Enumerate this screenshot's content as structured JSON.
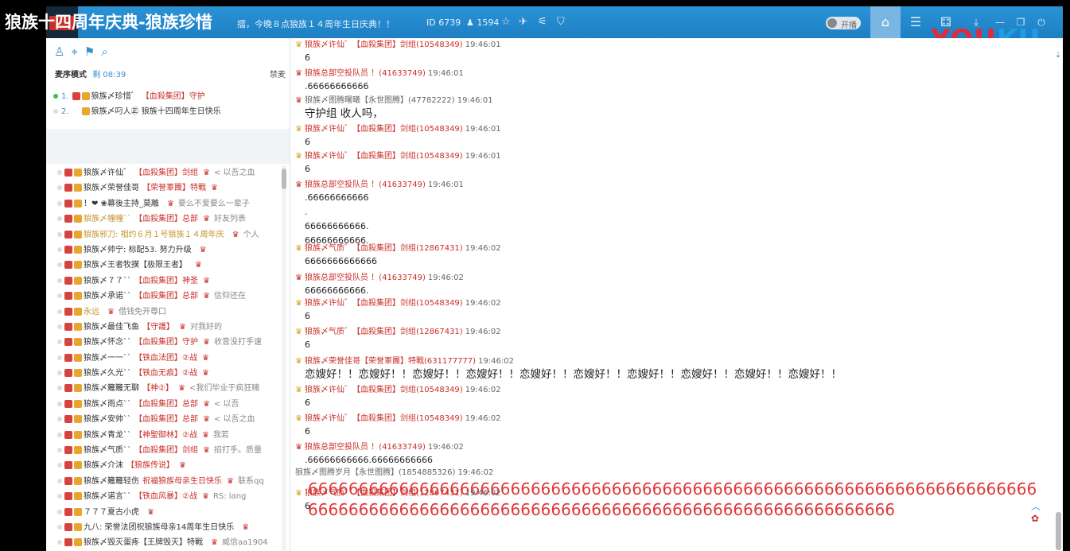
{
  "video_title": "狼族十四周年庆典-狼族珍惜",
  "topbar": {
    "marquee": "擂，今晚８点狼族１４周年生日庆典！！",
    "room_id": "ID 6739",
    "fans": "1594",
    "toggle_label": "开播",
    "icons": [
      "star-icon",
      "plane-icon",
      "share-icon",
      "shield-icon"
    ],
    "nav": [
      "home-icon",
      "list-icon",
      "gamepad-icon",
      "download-icon",
      "minimize-icon",
      "restore-icon",
      "power-icon"
    ]
  },
  "brand": {
    "part1": "YOU",
    "part2": "KU"
  },
  "sidebar": {
    "icons": [
      "user-icon",
      "location-icon",
      "mic-queue-icon",
      "search-icon"
    ],
    "mode_label": "麦序模式",
    "timer": "剩 08:39",
    "ban_label": "禁麦",
    "queue": [
      {
        "num": "1.",
        "name": "狼族〆珍惜゛",
        "tag": "【血殺集团】守护"
      },
      {
        "num": "2.",
        "name": "狼族〆叼人㊣",
        "tag": "狼族十四周年生日快乐"
      }
    ],
    "users": [
      {
        "name": "狼族〆许仙゛",
        "tag": "【血殺集团】剑组",
        "say": "< 以吾之血"
      },
      {
        "name": "狼族〆荣誉佳哥",
        "tag": "【荣誉軍團】特戰",
        "say": ""
      },
      {
        "name": "！❤︎ ❀幕後主持_莫離",
        "tag": "",
        "say": "要么不爱要么一辈子"
      },
      {
        "name": "狼族〆幢幢``",
        "tag": "【血殺集团】总部",
        "say": "好友列表",
        "gold": true
      },
      {
        "name": "狼族邪刀: 相约６月１号狼族１４周年庆",
        "tag": "",
        "say": "个人",
        "gold": true
      },
      {
        "name": "狼族〆帅宁: 标配53. 努力升级",
        "tag": "",
        "say": ""
      },
      {
        "name": "狼族〆王者牧撲【极限王者】",
        "tag": "",
        "say": ""
      },
      {
        "name": "狼族〆７７``",
        "tag": "【血殺集团】神圣",
        "say": ""
      },
      {
        "name": "狼族〆承诺``",
        "tag": "【血殺集团】总部",
        "say": "信仰还在"
      },
      {
        "name": "永远",
        "tag": "",
        "say": "借钱免开尊口",
        "gold": true
      },
      {
        "name": "狼族〆最佳飞鱼",
        "tag": "【守護】",
        "say": "对我好的"
      },
      {
        "name": "狼族〆怀念``",
        "tag": "【血殺集团】守护",
        "say": "收音没打手速"
      },
      {
        "name": "狼族〆一一``",
        "tag": "【铁血法团】②战",
        "say": ""
      },
      {
        "name": "狼族〆久光``",
        "tag": "【铁血无痕】②战",
        "say": ""
      },
      {
        "name": "狼族〆籬籬无聊",
        "tag": "【神②】",
        "say": "<我们毕业于疯狂赌"
      },
      {
        "name": "狼族〆雨点``",
        "tag": "【血殺集团】总部",
        "say": "< 以吾"
      },
      {
        "name": "狼族〆安帅``",
        "tag": "【血殺集团】总部",
        "say": "< 以吾之血"
      },
      {
        "name": "狼族〆青龙``",
        "tag": "【神聖御林】②战",
        "say": "我若"
      },
      {
        "name": "狼族〆气质``",
        "tag": "【血殺集团】剑组",
        "say": "招打手。质量"
      },
      {
        "name": "狼族〆介沫",
        "tag": "【狼族传说】",
        "say": ""
      },
      {
        "name": "狼族〆籬籬轻伤",
        "tag": "祝福狼族母亲生日快乐",
        "say": "联系qq"
      },
      {
        "name": "狼族〆诺言``",
        "tag": "【铁血风暴】②战",
        "say": "RS: lang"
      },
      {
        "name": "７７７夏古小虎",
        "tag": "",
        "say": ""
      },
      {
        "name": "九八: 荣誉法团祝狼族母亲14周年生日快乐",
        "tag": "",
        "say": ""
      },
      {
        "name": "狼族〆毁灭蛋疼【王牌毁灭】特戰",
        "tag": "",
        "say": "威信aa1904"
      }
    ]
  },
  "chat": [
    {
      "name": "狼族〆许仙゛【血殺集团】剑组(10548349)",
      "time": "19:46:01",
      "text": "6",
      "icon": "crown-gold"
    },
    {
      "name": "狼族总部空投队员 ！(41633749)",
      "time": "19:46:01",
      "text": ".66666666666",
      "icon": "crown"
    },
    {
      "name": "狼族〆图腾曙曦【永世图腾】(47782222)",
      "time": "19:46:01",
      "text": "守护组 收人吗，",
      "icon": "crown",
      "gray": true,
      "big": true
    },
    {
      "name": "狼族〆许仙゛【血殺集团】剑组(10548349)",
      "time": "19:46:01",
      "text": "6",
      "icon": "crown-gold"
    },
    {
      "name": "狼族〆许仙゛【血殺集团】剑组(10548349)",
      "time": "19:46:01",
      "text": "6",
      "icon": "crown-gold"
    },
    {
      "name": "狼族总部空投队员 ！(41633749)",
      "time": "19:46:01",
      "text": ".66666666666",
      "icon": "crown",
      "extra": [
        ".",
        "66666666666.",
        "66666666666."
      ]
    },
    {
      "name": "狼族〆气质゛【血殺集团】剑组(12867431)",
      "time": "19:46:02",
      "text": "6666666666666",
      "icon": "crown-gold"
    },
    {
      "name": "狼族总部空投队员 ！(41633749)",
      "time": "19:46:02",
      "text": "66666666666.",
      "icon": "crown"
    },
    {
      "name": "狼族〆许仙゛【血殺集团】剑组(10548349)",
      "time": "19:46:02",
      "text": "6",
      "icon": "crown-gold"
    },
    {
      "name": "狼族〆气质゛【血殺集团】剑组(12867431)",
      "time": "19:46:02",
      "text": "6",
      "icon": "crown-gold"
    },
    {
      "name": "狼族〆荣誉佳哥【荣誉軍團】特戰(631177777)",
      "time": "19:46:02",
      "text": "恋嫂好！！恋嫂好！！恋嫂好！！恋嫂好！！恋嫂好！！恋嫂好！！恋嫂好！！恋嫂好！！恋嫂好！！恋嫂好！！",
      "icon": "crown-gold",
      "big": true
    },
    {
      "name": "狼族〆许仙゛【血殺集团】剑组(10548349)",
      "time": "19:46:02",
      "text": "6",
      "icon": "crown-gold"
    },
    {
      "name": "狼族〆许仙゛【血殺集团】剑组(10548349)",
      "time": "19:46:02",
      "text": "6",
      "icon": "crown-gold"
    },
    {
      "name": "狼族总部空投队员 ！(41633749)",
      "time": "19:46:02",
      "text": ".66666666666.66666666666",
      "icon": "crown"
    },
    {
      "name": "狼族〆图腾岁月【永世图腾】(1854885326)",
      "time": "19:46:02",
      "text": "6666666666666666666666666666666666666666666666666666666666666666666666666666666666666666666666666666666666666666666666666666666666",
      "icon": "none",
      "gray": true,
      "red": true
    },
    {
      "name": "狼族〆气质゛【血殺集团】剑组(12867431)",
      "time": "19:46:02",
      "text": "6",
      "icon": "crown-gold"
    }
  ],
  "colors": {
    "topbar": "#2a93d5",
    "accent": "#3a8fd0",
    "name_red": "#c8302a",
    "big_red": "#e03838"
  }
}
